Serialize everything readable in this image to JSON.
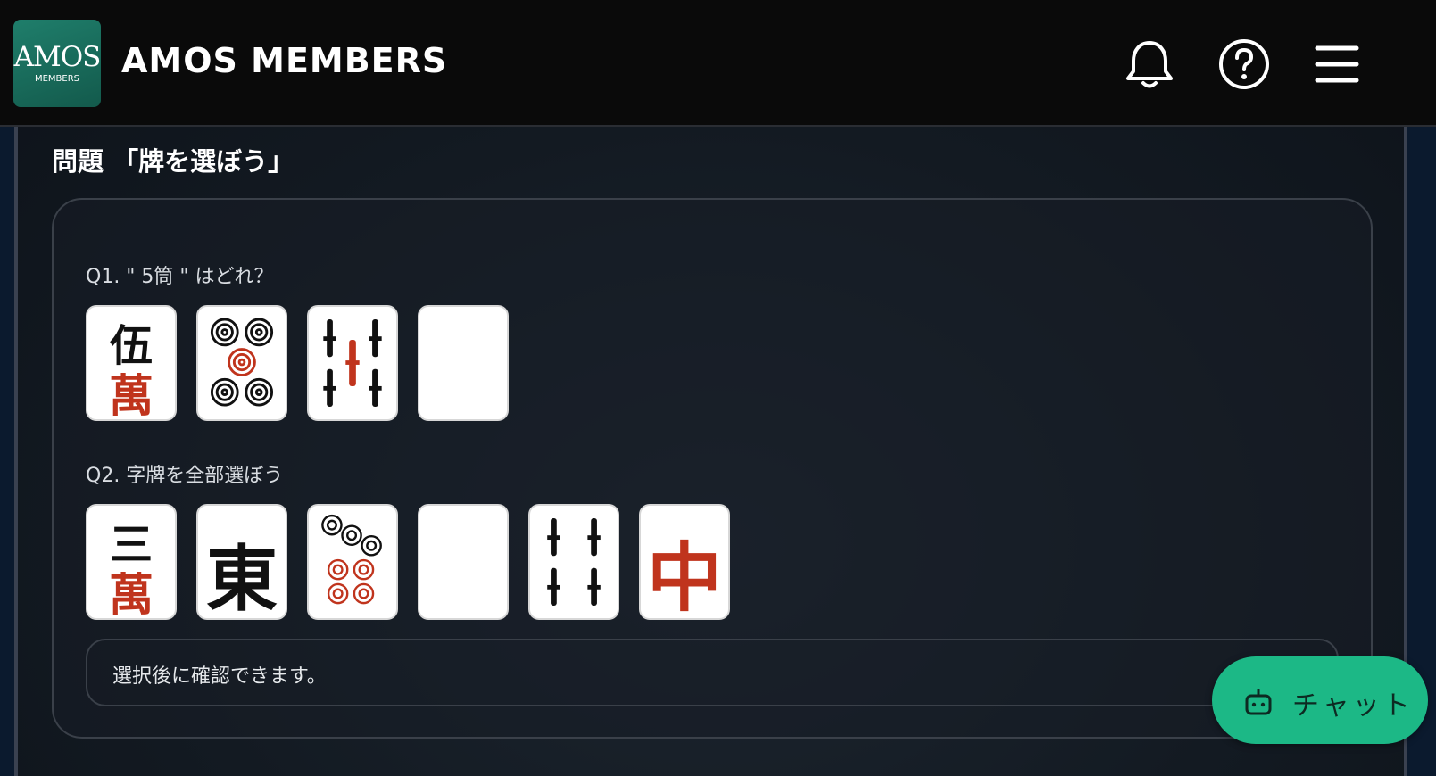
{
  "header": {
    "logo_main": "AMOS",
    "logo_sub": "MEMBERS",
    "title": "AMOS MEMBERS",
    "icons": [
      "bell-icon",
      "help-icon",
      "menu-icon"
    ]
  },
  "section": {
    "title": "問題 「牌を選ぼう」"
  },
  "questions": [
    {
      "label": "Q1. \" 5筒 \" はどれ？",
      "tiles": [
        "5-man",
        "5-pin",
        "5-sou",
        "haku-white"
      ]
    },
    {
      "label": "Q2. 字牌を全部選ぼう",
      "tiles": [
        "3-man",
        "east",
        "7-pin",
        "haku-white",
        "4-sou",
        "chun-red"
      ]
    }
  ],
  "tile_glyphs": {
    "five": "伍",
    "man": "萬",
    "three": "三",
    "east": "東",
    "chun": "中"
  },
  "note": "選択後に確認できます。",
  "chat": {
    "label": "チャット",
    "icon": "bot-icon"
  },
  "colors": {
    "accent": "#1cb886",
    "tile_red": "#c0341d",
    "header_bg": "#0a0a0a"
  }
}
